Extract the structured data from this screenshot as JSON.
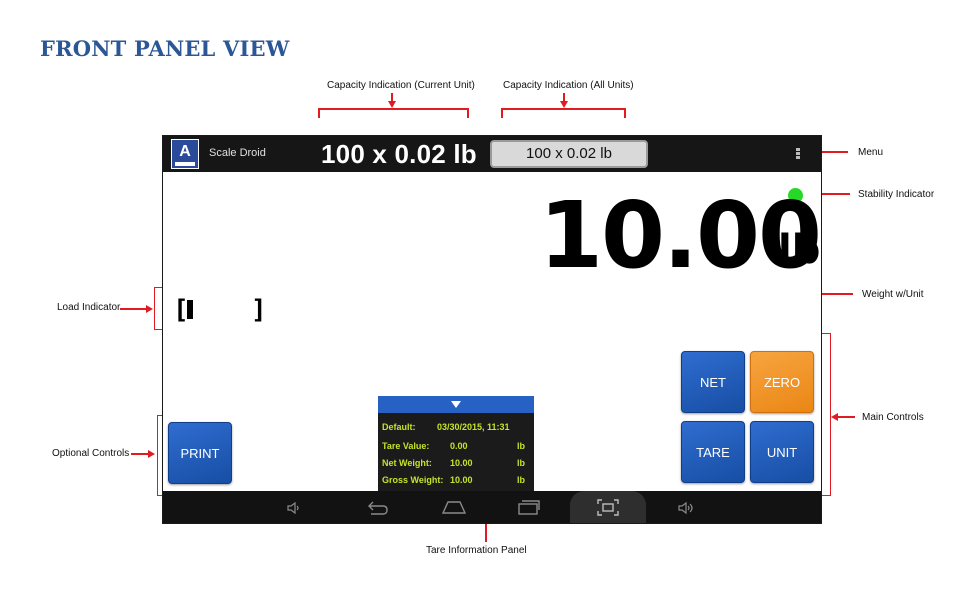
{
  "heading": "FRONT PANEL VIEW",
  "callouts": {
    "capacity_current": "Capacity Indication (Current Unit)",
    "capacity_all": "Capacity Indication (All Units)",
    "menu": "Menu",
    "stability": "Stability Indicator",
    "weight_unit": "Weight w/Unit",
    "load": "Load Indicator",
    "main_controls": "Main Controls",
    "optional_controls": "Optional Controls",
    "tare_panel": "Tare Information Panel"
  },
  "app": {
    "logo_letter": "A",
    "name": "Scale Droid",
    "capacity_current": "100 x 0.02 lb",
    "capacity_all": "100 x 0.02 lb"
  },
  "display": {
    "weight": "10.00",
    "unit": "lb",
    "stability_color": "#27d827",
    "load_open": "[",
    "load_close": "]"
  },
  "buttons": {
    "net": "NET",
    "zero": "ZERO",
    "tare": "TARE",
    "unit": "UNIT",
    "print": "PRINT"
  },
  "tare_panel": {
    "default_label": "Default:",
    "default_value": "03/30/2015, 11:31",
    "tare_label": "Tare Value:",
    "tare_value": "0.00",
    "tare_unit": "lb",
    "net_label": "Net Weight:",
    "net_value": "10.00",
    "net_unit": "lb",
    "gross_label": "Gross Weight:",
    "gross_value": "10.00",
    "gross_unit": "lb"
  },
  "nav_icons": [
    "volume-down-icon",
    "back-icon",
    "home-icon",
    "recents-icon",
    "screenshot-icon",
    "volume-up-icon"
  ],
  "colors": {
    "accent_blue": "#2761c4",
    "button_orange": "#ea8715",
    "annotation_red": "#e11b22",
    "heading_blue": "#2b5797"
  }
}
